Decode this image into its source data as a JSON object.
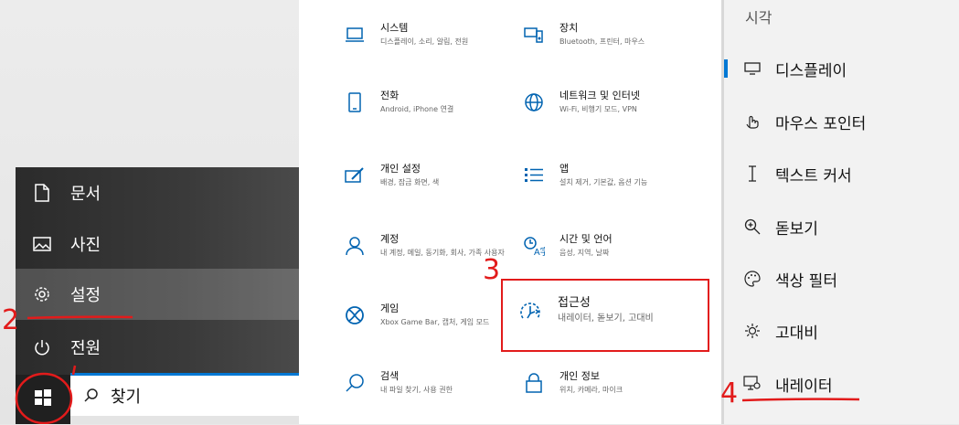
{
  "start_menu": {
    "items": [
      {
        "label": "문서",
        "icon": "document-icon"
      },
      {
        "label": "사진",
        "icon": "photo-icon"
      },
      {
        "label": "설정",
        "icon": "gear-icon"
      },
      {
        "label": "전원",
        "icon": "power-icon"
      }
    ]
  },
  "taskbar": {
    "search_label": "찾기"
  },
  "settings": {
    "tiles": [
      {
        "title": "시스템",
        "sub": "디스플레이, 소리, 알림, 전원",
        "icon": "laptop-icon"
      },
      {
        "title": "장치",
        "sub": "Bluetooth, 프린터, 마우스",
        "icon": "devices-icon"
      },
      {
        "title": "전화",
        "sub": "Android, iPhone 연결",
        "icon": "phone-icon"
      },
      {
        "title": "네트워크 및 인터넷",
        "sub": "Wi-Fi, 비행기 모드, VPN",
        "icon": "globe-icon"
      },
      {
        "title": "개인 설정",
        "sub": "배경, 잠금 화면, 색",
        "icon": "personalization-icon"
      },
      {
        "title": "앱",
        "sub": "설치 제거, 기본값, 옵션 기능",
        "icon": "apps-icon"
      },
      {
        "title": "계정",
        "sub": "내 계정, 메일, 동기화, 회사, 가족 사용자",
        "icon": "person-icon"
      },
      {
        "title": "시간 및 언어",
        "sub": "음성, 지역, 날짜",
        "icon": "time-language-icon"
      },
      {
        "title": "게임",
        "sub": "Xbox Game Bar, 캡처, 게임 모드",
        "icon": "xbox-icon"
      },
      {
        "title": "접근성",
        "sub": "내레이터, 돋보기, 고대비",
        "icon": "accessibility-icon"
      },
      {
        "title": "검색",
        "sub": "내 파일 찾기, 사용 권한",
        "icon": "search-icon"
      },
      {
        "title": "개인 정보",
        "sub": "위치, 카메라, 마이크",
        "icon": "lock-icon"
      }
    ]
  },
  "accessibility_nav": {
    "section_title": "시각",
    "items": [
      {
        "label": "디스플레이",
        "icon": "monitor-icon"
      },
      {
        "label": "마우스 포인터",
        "icon": "pointer-icon"
      },
      {
        "label": "텍스트 커서",
        "icon": "text-cursor-icon"
      },
      {
        "label": "돋보기",
        "icon": "magnifier-icon"
      },
      {
        "label": "색상 필터",
        "icon": "palette-icon"
      },
      {
        "label": "고대비",
        "icon": "sun-icon"
      },
      {
        "label": "내레이터",
        "icon": "narrator-icon"
      }
    ]
  },
  "annotations": {
    "step2": "2",
    "step3": "3",
    "step4": "4",
    "accent_color": "#e21b1b"
  },
  "colors": {
    "accent": "#0078d4",
    "start_menu_bg": "#2b2b2b"
  }
}
